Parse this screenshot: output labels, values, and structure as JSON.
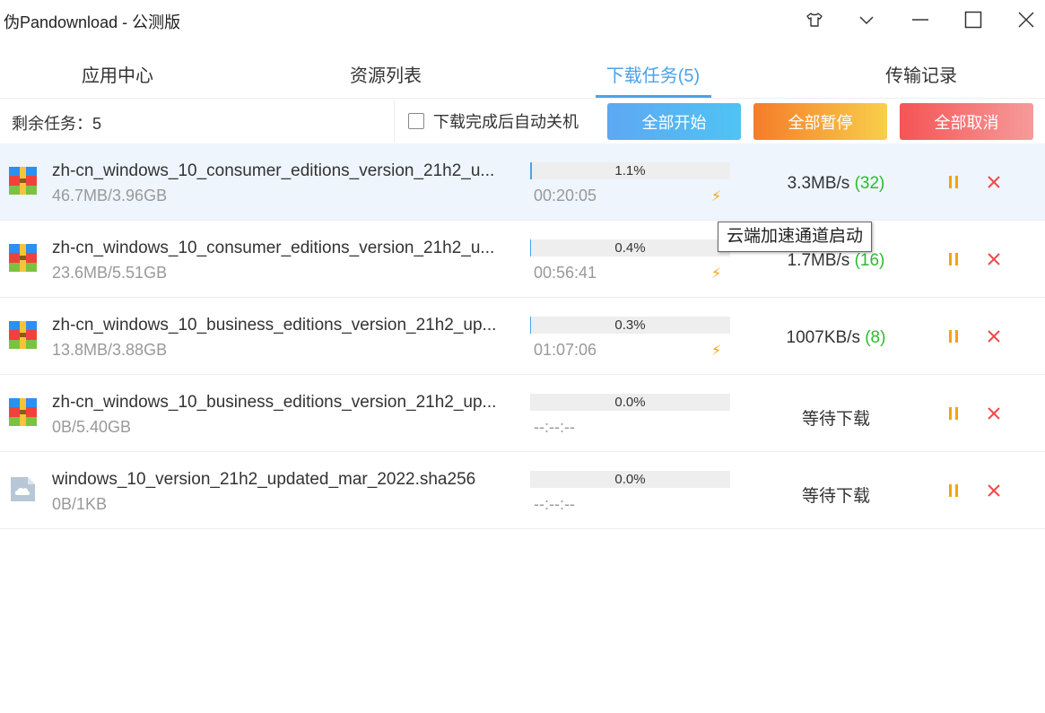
{
  "window": {
    "title": "伪Pandownload - 公测版"
  },
  "tabs": [
    {
      "label": "应用中心",
      "active": false
    },
    {
      "label": "资源列表",
      "active": false
    },
    {
      "label": "下载任务(5)",
      "active": true
    },
    {
      "label": "传输记录",
      "active": false
    }
  ],
  "toolbar": {
    "remaining": "剩余任务：5",
    "shutdown_label": "下载完成后自动关机",
    "shutdown_checked": false,
    "start_all": "全部开始",
    "pause_all": "全部暂停",
    "cancel_all": "全部取消"
  },
  "tasks": [
    {
      "name": "zh-cn_windows_10_consumer_editions_version_21h2_u...",
      "size": "46.7MB/3.96GB",
      "progress_pct": "1.1%",
      "progress": 0.011,
      "eta": "00:20:05",
      "boosted": true,
      "speed": "3.3MB/s ",
      "connections": "(32)",
      "icon": "archive-icon"
    },
    {
      "name": "zh-cn_windows_10_consumer_editions_version_21h2_u...",
      "size": "23.6MB/5.51GB",
      "progress_pct": "0.4%",
      "progress": 0.004,
      "eta": "00:56:41",
      "boosted": true,
      "speed": "1.7MB/s ",
      "connections": "(16)",
      "icon": "archive-icon"
    },
    {
      "name": "zh-cn_windows_10_business_editions_version_21h2_up...",
      "size": "13.8MB/3.88GB",
      "progress_pct": "0.3%",
      "progress": 0.003,
      "eta": "01:07:06",
      "boosted": true,
      "speed": "1007KB/s ",
      "connections": "(8)",
      "icon": "archive-icon"
    },
    {
      "name": "zh-cn_windows_10_business_editions_version_21h2_up...",
      "size": "0B/5.40GB",
      "progress_pct": "0.0%",
      "progress": 0.0,
      "eta": "--:--:--",
      "boosted": false,
      "speed": "等待下载",
      "connections": "",
      "icon": "archive-icon"
    },
    {
      "name": "windows_10_version_21h2_updated_mar_2022.sha256",
      "size": "0B/1KB",
      "progress_pct": "0.0%",
      "progress": 0.0,
      "eta": "--:--:--",
      "boosted": false,
      "speed": "等待下载",
      "connections": "",
      "icon": "cloud-file-icon"
    }
  ],
  "tooltip": {
    "text": "云端加速通道启动"
  },
  "colors": {
    "accent": "#4aa3ec",
    "warning": "#f4a30f",
    "danger": "#f04a4a",
    "success": "#2dbb2d"
  },
  "icons": {
    "skin": "shirt-icon",
    "menu": "chevron-down-icon",
    "minimize": "minimize-icon",
    "maximize": "maximize-icon",
    "close": "close-icon",
    "boost": "lightning-icon",
    "pause": "pause-icon",
    "cancel": "close-icon"
  }
}
